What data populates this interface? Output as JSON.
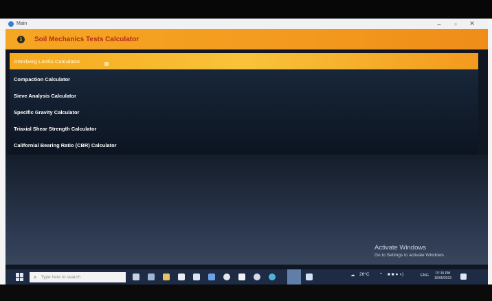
{
  "window": {
    "title": "Main",
    "controls": {
      "minimize": "–",
      "maximize": "▫",
      "close": "✕"
    }
  },
  "header": {
    "icon": "info-icon",
    "title": "Soil Mechanics Tests Calculator"
  },
  "menu": {
    "selected_index": 0,
    "items": [
      {
        "label": "Atterberg Limits Calculator"
      },
      {
        "label": "Compaction Calculator"
      },
      {
        "label": "Sieve Analysis Calculator"
      },
      {
        "label": "Specific Gravity Calculator"
      },
      {
        "label": "Triaxial Shear Strength Calculator"
      },
      {
        "label": "Californial Bearing Ratio (CBR) Calculator"
      }
    ]
  },
  "watermark": {
    "title": "Activate Windows",
    "subtitle": "Go to Settings to activate Windows."
  },
  "taskbar": {
    "search_placeholder": "Type here to search",
    "weather": "26°C",
    "language": "ENG",
    "time": "07:15 PM",
    "date": "10/05/2023"
  }
}
